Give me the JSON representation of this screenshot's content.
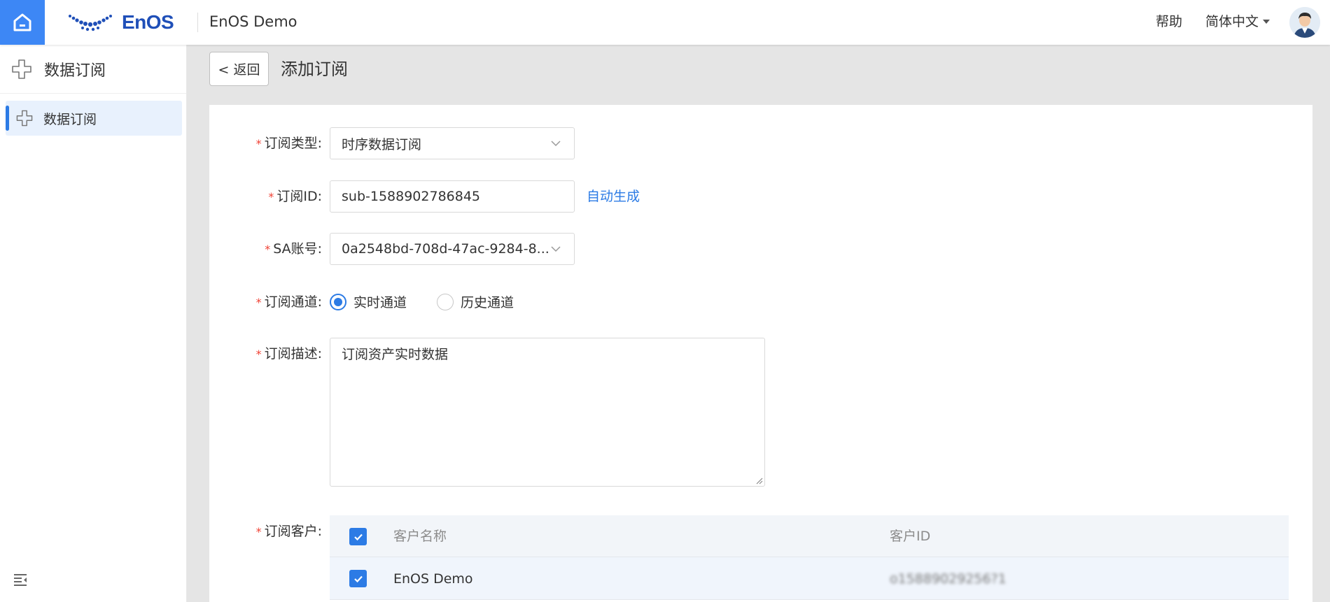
{
  "header": {
    "brand_logo": "EnOS",
    "app_name": "EnOS Demo",
    "help_label": "帮助",
    "language": "简体中文"
  },
  "sidebar": {
    "title": "数据订阅",
    "items": [
      {
        "label": "数据订阅",
        "active": true
      }
    ]
  },
  "page": {
    "back_label": "< 返回",
    "title": "添加订阅"
  },
  "form": {
    "required_mark": "*",
    "type": {
      "label": "订阅类型:",
      "value": "时序数据订阅"
    },
    "sub_id": {
      "label": "订阅ID:",
      "value": "sub-1588902786845",
      "auto_label": "自动生成"
    },
    "sa_account": {
      "label": "SA账号:",
      "value": "0a2548bd-708d-47ac-9284-8..."
    },
    "channel": {
      "label": "订阅通道:",
      "options": [
        {
          "label": "实时通道",
          "selected": true
        },
        {
          "label": "历史通道",
          "selected": false
        }
      ]
    },
    "description": {
      "label": "订阅描述:",
      "value": "订阅资产实时数据"
    },
    "customers": {
      "label": "订阅客户:",
      "columns": [
        "客户名称",
        "客户ID"
      ],
      "rows": [
        {
          "name": "EnOS Demo",
          "id": "o15889029256?1",
          "checked": true
        }
      ]
    }
  },
  "colors": {
    "primary": "#2c7be5",
    "home_button": "#3d87f5",
    "required": "#f04134"
  }
}
